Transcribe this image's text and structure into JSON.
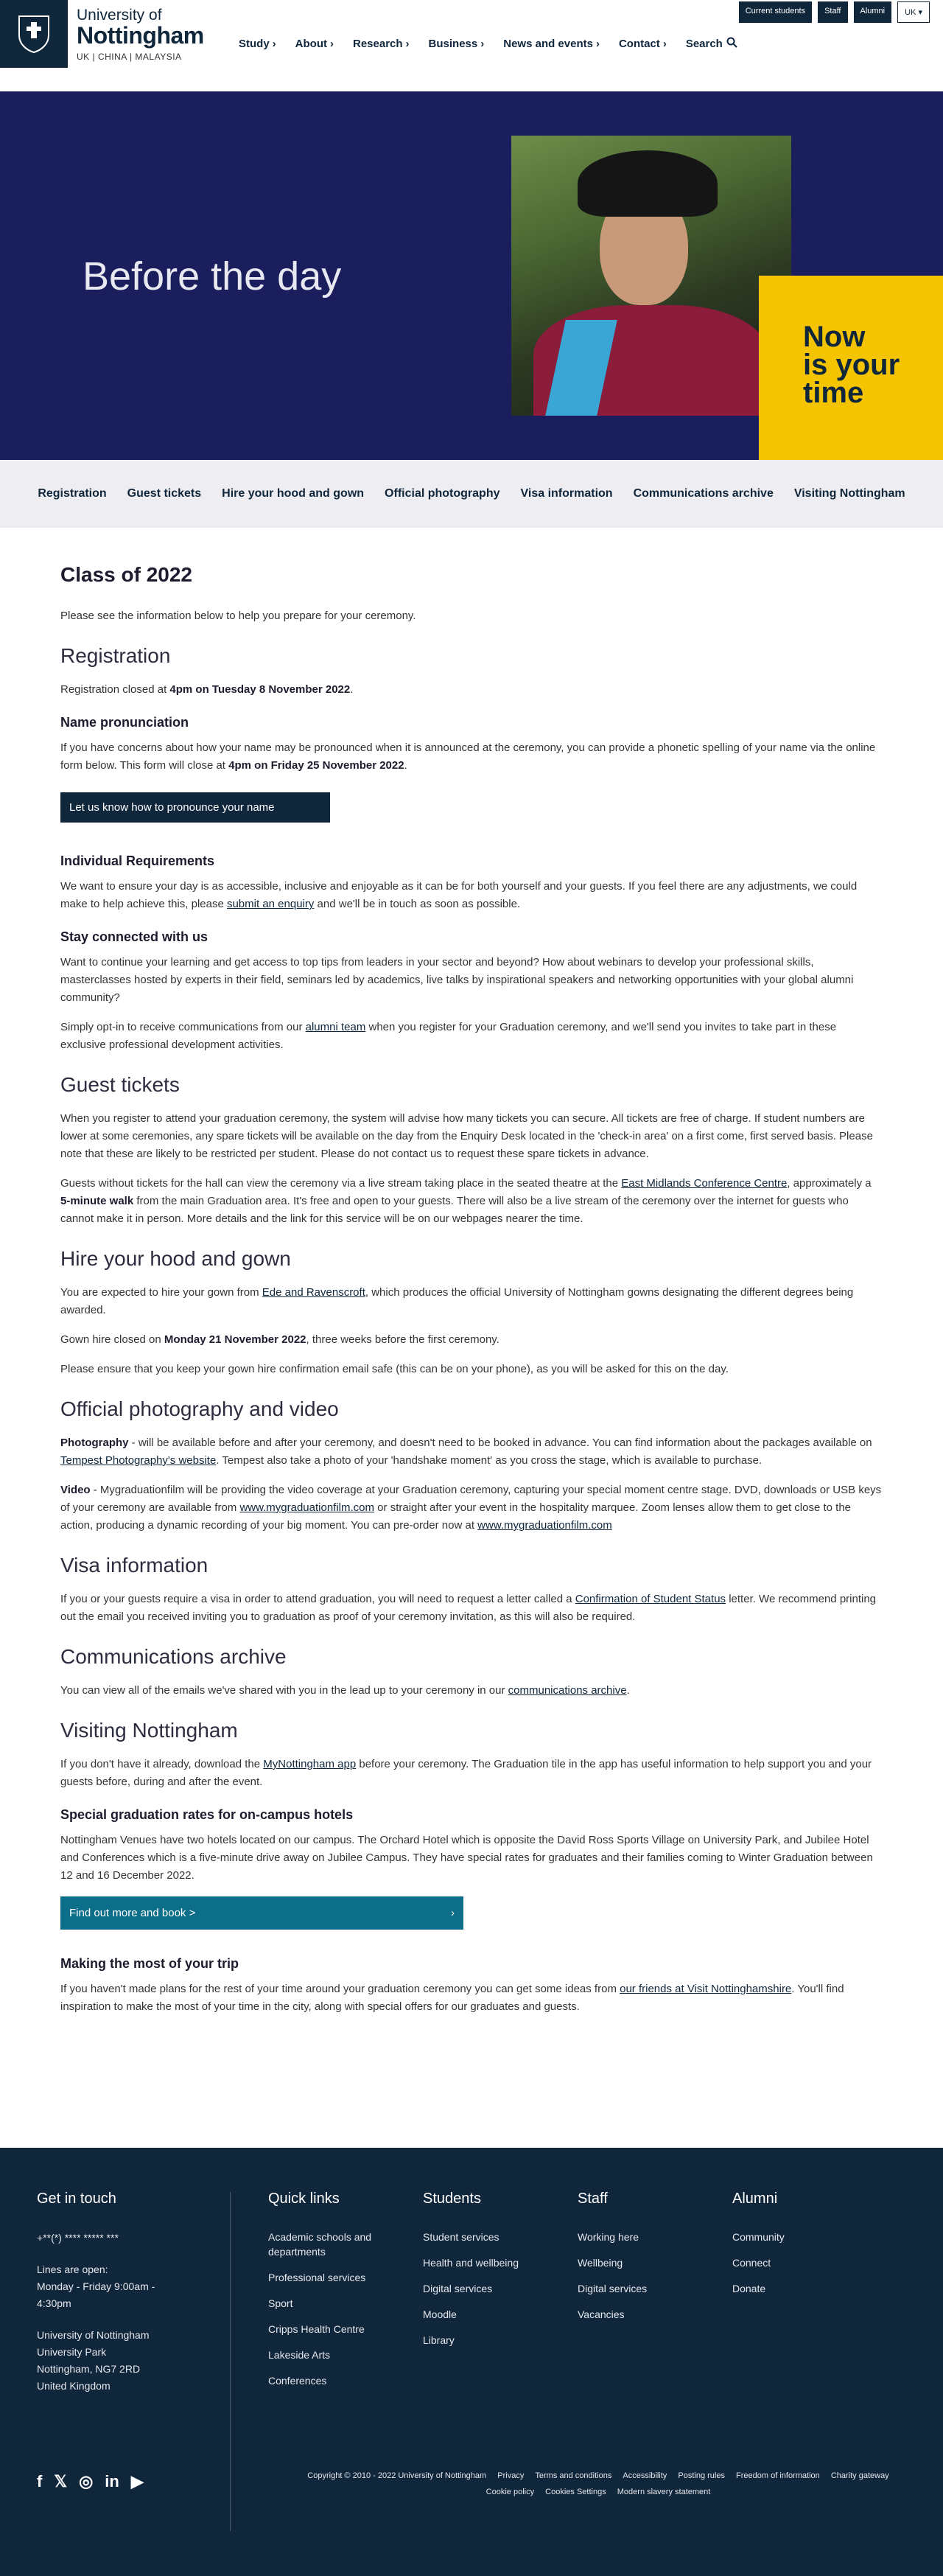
{
  "header": {
    "logo_line1": "University of",
    "logo_line2": "Nottingham",
    "logo_line3": "UK | CHINA | MALAYSIA",
    "utility": [
      "Current students",
      "Staff",
      "Alumni",
      "UK"
    ],
    "nav": [
      "Study",
      "About",
      "Research",
      "Business",
      "News and events",
      "Contact"
    ],
    "search_label": "Search"
  },
  "hero": {
    "title": "Before the day",
    "tagline_1": "Now",
    "tagline_2": "is your",
    "tagline_3": "time"
  },
  "subnav": [
    "Registration",
    "Guest tickets",
    "Hire your hood and gown",
    "Official photography",
    "Visa information",
    "Communications archive",
    "Visiting Nottingham"
  ],
  "content": {
    "page_title": "Class of 2022",
    "intro": "Please see the information below to help you prepare for your ceremony.",
    "registration": {
      "heading": "Registration",
      "closed_prefix": "Registration closed at ",
      "closed_bold": "4pm on Tuesday 8 November 2022",
      "closed_suffix": ".",
      "pron_heading": "Name pronunciation",
      "pron_text": "If you have concerns about how your name may be pronounced when it is announced at the ceremony, you can provide a phonetic spelling of your name via the online form below.  This form will close at ",
      "pron_bold": "4pm on Friday 25 November 2022",
      "pron_suffix": ".",
      "pron_button": "Let us know how to pronounce your name",
      "ind_heading": "Individual Requirements",
      "ind_text1": "We want to ensure your day is as accessible, inclusive and enjoyable as it can be for both yourself and your guests.  If you feel there are any adjustments, we could make to help achieve this, please ",
      "ind_link": "submit an enquiry",
      "ind_text2": " and we'll be in touch as soon as possible.",
      "stay_heading": "Stay connected with us",
      "stay_text": "Want to continue your learning and get access to top tips from leaders in your sector and beyond? How about webinars to develop your professional skills, masterclasses hosted by experts in their field, seminars led by academics, live talks by inspirational speakers and networking opportunities with your global alumni community?",
      "optin_text1": "Simply opt-in to receive communications from our ",
      "optin_link": "alumni team",
      "optin_text2": " when you register for your Graduation ceremony, and we'll send you invites to take part in these exclusive professional development activities."
    },
    "guest": {
      "heading": "Guest tickets",
      "text1": "When you register to attend your graduation ceremony, the system will advise how many tickets you can secure. All tickets are free of charge. If student numbers are lower at some ceremonies, any spare tickets will be available on the day from the Enquiry Desk located in the 'check-in area' on a first come, first served basis. Please note that these are likely to be restricted per student. Please do not contact us to request these spare tickets in advance.",
      "text2a": "Guests without tickets for the hall can view the ceremony via a live stream taking place in the seated theatre at the ",
      "text2_link": "East Midlands Conference Centre",
      "text2b": ", approximately a ",
      "text2_bold": "5-minute walk",
      "text2c": " from the main Graduation area. It's free and open to your guests. There will also be a live stream of the ceremony over the internet for guests who cannot make it in person. More details and the link for this service will be on our webpages nearer the time."
    },
    "gown": {
      "heading": "Hire your hood and gown",
      "text1a": "You are expected to hire your gown from ",
      "text1_link": "Ede and Ravenscroft",
      "text1b": ", which produces the official University of Nottingham gowns designating the different degrees being awarded.",
      "text2a": "Gown hire closed on ",
      "text2_bold": "Monday 21 November 2022",
      "text2b": ", three weeks before the first ceremony.",
      "text3": "Please ensure that you keep your gown hire confirmation email safe (this can be on your phone), as you will be asked for this on the day."
    },
    "photo": {
      "heading": "Official photography and video",
      "p1_bold": "Photography",
      "p1a": " - will be available before and after your ceremony, and doesn't need to be booked in advance. You can find information about the packages available on ",
      "p1_link": "Tempest Photography's website",
      "p1b": ". Tempest also take a photo of your 'handshake moment' as you cross the stage, which is available to purchase.",
      "p2_bold": "Video",
      "p2a": " - Mygraduationfilm will be providing the video coverage at your Graduation ceremony, capturing your special moment centre stage. DVD, downloads or USB keys of your ceremony are available from ",
      "p2_link1": "www.mygraduationfilm.com",
      "p2b": " or straight after your event in the hospitality marquee. Zoom lenses allow them to get close to the action, producing a dynamic recording of your big moment. You can pre-order now at ",
      "p2_link2": "www.mygraduationfilm.com"
    },
    "visa": {
      "heading": "Visa information",
      "text_a": "If you or your guests require a visa in order to attend graduation, you will need to request a letter called a ",
      "text_link": "Confirmation of Student Status",
      "text_b": " letter. We recommend printing out the email you received inviting you to graduation as proof of your ceremony invitation, as this will also be required."
    },
    "comms": {
      "heading": "Communications archive",
      "text_a": "You can view all of the emails we've shared with you in the lead up to your ceremony in our ",
      "text_link": "communications archive",
      "text_b": "."
    },
    "visiting": {
      "heading": "Visiting Nottingham",
      "text_a": "If you don't have it already, download the ",
      "text_link": "MyNottingham app",
      "text_b": " before your ceremony. The Graduation tile in the app has useful information to help support you and your guests before, during and after the event.",
      "hotels_heading": "Special graduation rates for on-campus hotels",
      "hotels_text": "Nottingham Venues have two hotels located on our campus. The Orchard Hotel which is opposite the David Ross Sports Village on University Park, and Jubilee Hotel and Conferences which is a five-minute drive away on Jubilee Campus. They have special rates for graduates and their families coming to Winter Graduation between 12 and 16 December 2022.",
      "book_button": "Find out more and book >",
      "book_arrow": "›",
      "trip_heading": "Making the most of your trip",
      "trip_a": "If you haven't made plans for the rest of your time around your graduation ceremony you can get some ideas from ",
      "trip_link": "our friends at Visit Nottinghamshire",
      "trip_b": ". You'll find inspiration to make the most of your time in the city, along with special offers for our graduates and guests."
    }
  },
  "footer": {
    "contact_heading": "Get in touch",
    "phone": "+**(*) **** ***** ***",
    "lines_label": "Lines are open:",
    "lines_hours_1": "Monday - Friday 9:00am -",
    "lines_hours_2": "4:30pm",
    "address": [
      "University of Nottingham",
      "University Park",
      "Nottingham, NG7 2RD",
      "United Kingdom"
    ],
    "quick_heading": "Quick links",
    "quick_links": [
      "Academic schools and departments",
      "Professional services",
      "Sport",
      "Cripps Health Centre",
      "Lakeside Arts",
      "Conferences"
    ],
    "students_heading": "Students",
    "students_links": [
      "Student services",
      "Health and wellbeing",
      "Digital services",
      "Moodle",
      "Library"
    ],
    "staff_heading": "Staff",
    "staff_links": [
      "Working here",
      "Wellbeing",
      "Digital services",
      "Vacancies"
    ],
    "alumni_heading": "Alumni",
    "alumni_links": [
      "Community",
      "Connect",
      "Donate"
    ],
    "legal_row1": [
      "Copyright © 2010 - 2022 University of Nottingham",
      "Privacy",
      "Terms and conditions",
      "Accessibility",
      "Posting rules",
      "Freedom of information",
      "Charity gateway"
    ],
    "legal_row2": [
      "Cookie policy",
      "Cookies Settings",
      "Modern slavery statement"
    ]
  }
}
